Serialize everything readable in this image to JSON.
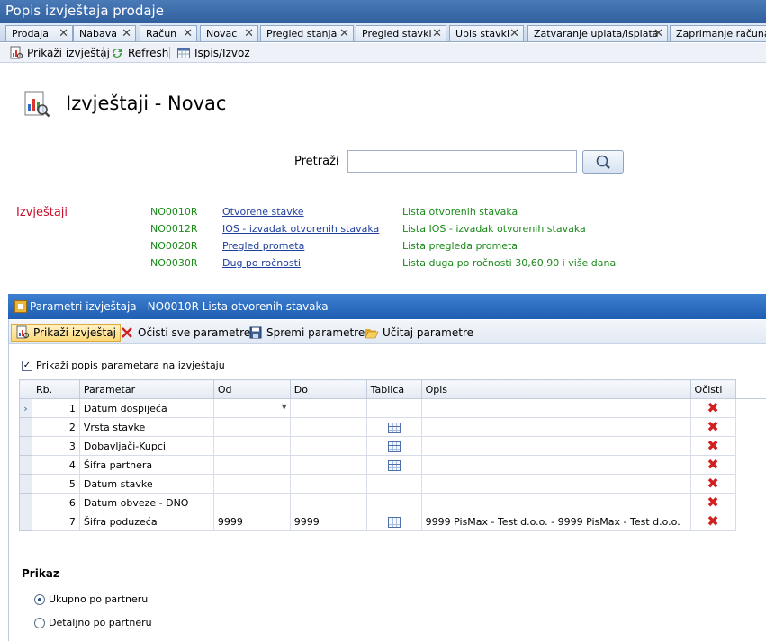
{
  "window": {
    "title": "Popis izvještaja prodaje"
  },
  "tabs": [
    {
      "label": "Prodaja"
    },
    {
      "label": "Nabava"
    },
    {
      "label": "Račun"
    },
    {
      "label": "Novac"
    },
    {
      "label": "Pregled stanja"
    },
    {
      "label": "Pregled stavki"
    },
    {
      "label": "Upis stavki"
    },
    {
      "label": "Zatvaranje uplata/isplata"
    },
    {
      "label": "Zaprimanje računa"
    }
  ],
  "toolbar": {
    "show_report": "Prikaži izvještaj",
    "refresh": "Refresh",
    "print_export": "Ispis/Izvoz"
  },
  "page": {
    "title": "Izvještaji - Novac"
  },
  "search": {
    "label": "Pretraži",
    "value": "",
    "placeholder": ""
  },
  "reports": {
    "heading": "Izvještaji",
    "items": [
      {
        "code": "NO0010R",
        "name": "Otvorene stavke",
        "description": "Lista otvorenih stavaka"
      },
      {
        "code": "NO0012R",
        "name": "IOS - izvadak otvorenih stavaka",
        "description": "Lista IOS - izvadak otvorenih stavaka"
      },
      {
        "code": "NO0020R",
        "name": "Pregled prometa",
        "description": "Lista pregleda prometa"
      },
      {
        "code": "NO0030R",
        "name": "Dug po ročnosti",
        "description": "Lista duga po ročnosti 30,60,90 i više dana"
      }
    ]
  },
  "panel": {
    "title": "Parametri izvještaja - NO0010R Lista otvorenih stavaka",
    "toolbar": {
      "show_report": "Prikaži izvještaj",
      "clear_all": "Očisti sve parametre",
      "save_params": "Spremi parametre",
      "load_params": "Učitaj parametre"
    },
    "show_params_checkbox": {
      "label": "Prikaži popis parametara na izvještaju",
      "checked": true
    },
    "grid": {
      "columns": {
        "rb": "Rb.",
        "param": "Parametar",
        "od": "Od",
        "do": "Do",
        "table": "Tablica",
        "desc": "Opis",
        "clear": "Očisti"
      },
      "rows": [
        {
          "rb": "1",
          "param": "Datum dospijeća",
          "od": "",
          "do": "",
          "desc": "",
          "has_table": false
        },
        {
          "rb": "2",
          "param": "Vrsta stavke",
          "od": "",
          "do": "",
          "desc": "",
          "has_table": true
        },
        {
          "rb": "3",
          "param": "Dobavljači-Kupci",
          "od": "",
          "do": "",
          "desc": "",
          "has_table": true
        },
        {
          "rb": "4",
          "param": "Šifra partnera",
          "od": "",
          "do": "",
          "desc": "",
          "has_table": true
        },
        {
          "rb": "5",
          "param": "Datum stavke",
          "od": "",
          "do": "",
          "desc": "",
          "has_table": false
        },
        {
          "rb": "6",
          "param": "Datum obveze - DNO",
          "od": "",
          "do": "",
          "desc": "",
          "has_table": false
        },
        {
          "rb": "7",
          "param": "Šifra poduzeća",
          "od": "9999",
          "do": "9999",
          "desc": "9999 PisMax - Test d.o.o. - 9999 PisMax - Test d.o.o.",
          "has_table": true
        }
      ]
    },
    "display": {
      "title": "Prikaz",
      "options": [
        {
          "label": "Ukupno po partneru",
          "selected": true
        },
        {
          "label": "Detaljno po partneru",
          "selected": false
        }
      ]
    }
  },
  "colors": {
    "title_bar": "#2f5f9e",
    "panel_header": "#1f5fb3",
    "report_heading": "#c8102e",
    "code_green": "#1a8a1a",
    "link_blue": "#1f3f9f",
    "delete_red": "#d22020"
  }
}
